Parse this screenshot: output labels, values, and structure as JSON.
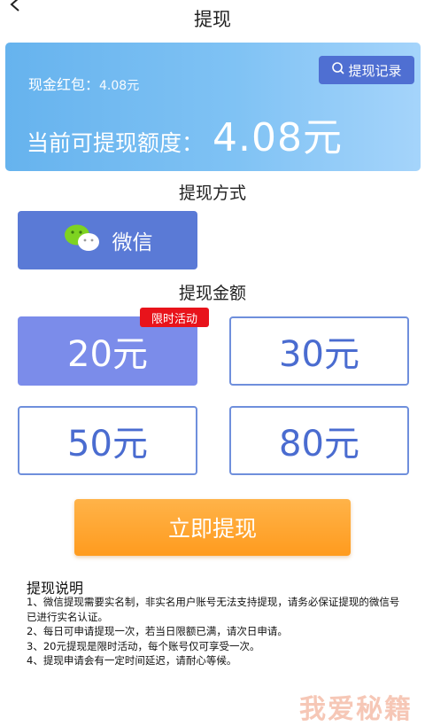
{
  "header": {
    "title": "提现"
  },
  "balance": {
    "record_button": "提现记录",
    "cash_label": "现金红包：",
    "cash_value": "4.08元",
    "available_label": "当前可提现额度：",
    "available_amount": "4.08元"
  },
  "method": {
    "title": "提现方式",
    "wechat_label": "微信"
  },
  "amount": {
    "title": "提现金额",
    "badge": "限时活动",
    "options": [
      {
        "label": "20元",
        "selected": true
      },
      {
        "label": "30元",
        "selected": false
      },
      {
        "label": "50元",
        "selected": false
      },
      {
        "label": "80元",
        "selected": false
      }
    ]
  },
  "submit_label": "立即提现",
  "notes": {
    "title": "提现说明",
    "items": [
      "1、微信提现需要实名制，非实名用户账号无法支持提现，请务必保证提现的微信号已进行实名认证。",
      "2、每日可申请提现一次，若当日限额已满，请次日申请。",
      "3、20元提现是限时活动，每个账号仅可享受一次。",
      "4、提现申请会有一定时间延迟，请耐心等候。"
    ]
  },
  "watermark": "我爱秘籍",
  "colors": {
    "card": "#7fc2f4",
    "record_button": "#4f6fd2",
    "wechat_button": "#5a7ad6",
    "selected_option": "#7b8cea",
    "option_border": "#6f8fdc",
    "badge": "#e8131b",
    "submit": "#ff9b1e"
  },
  "icons": {
    "back": "back-arrow-icon",
    "record": "search-icon",
    "wechat": "wechat-icon"
  }
}
